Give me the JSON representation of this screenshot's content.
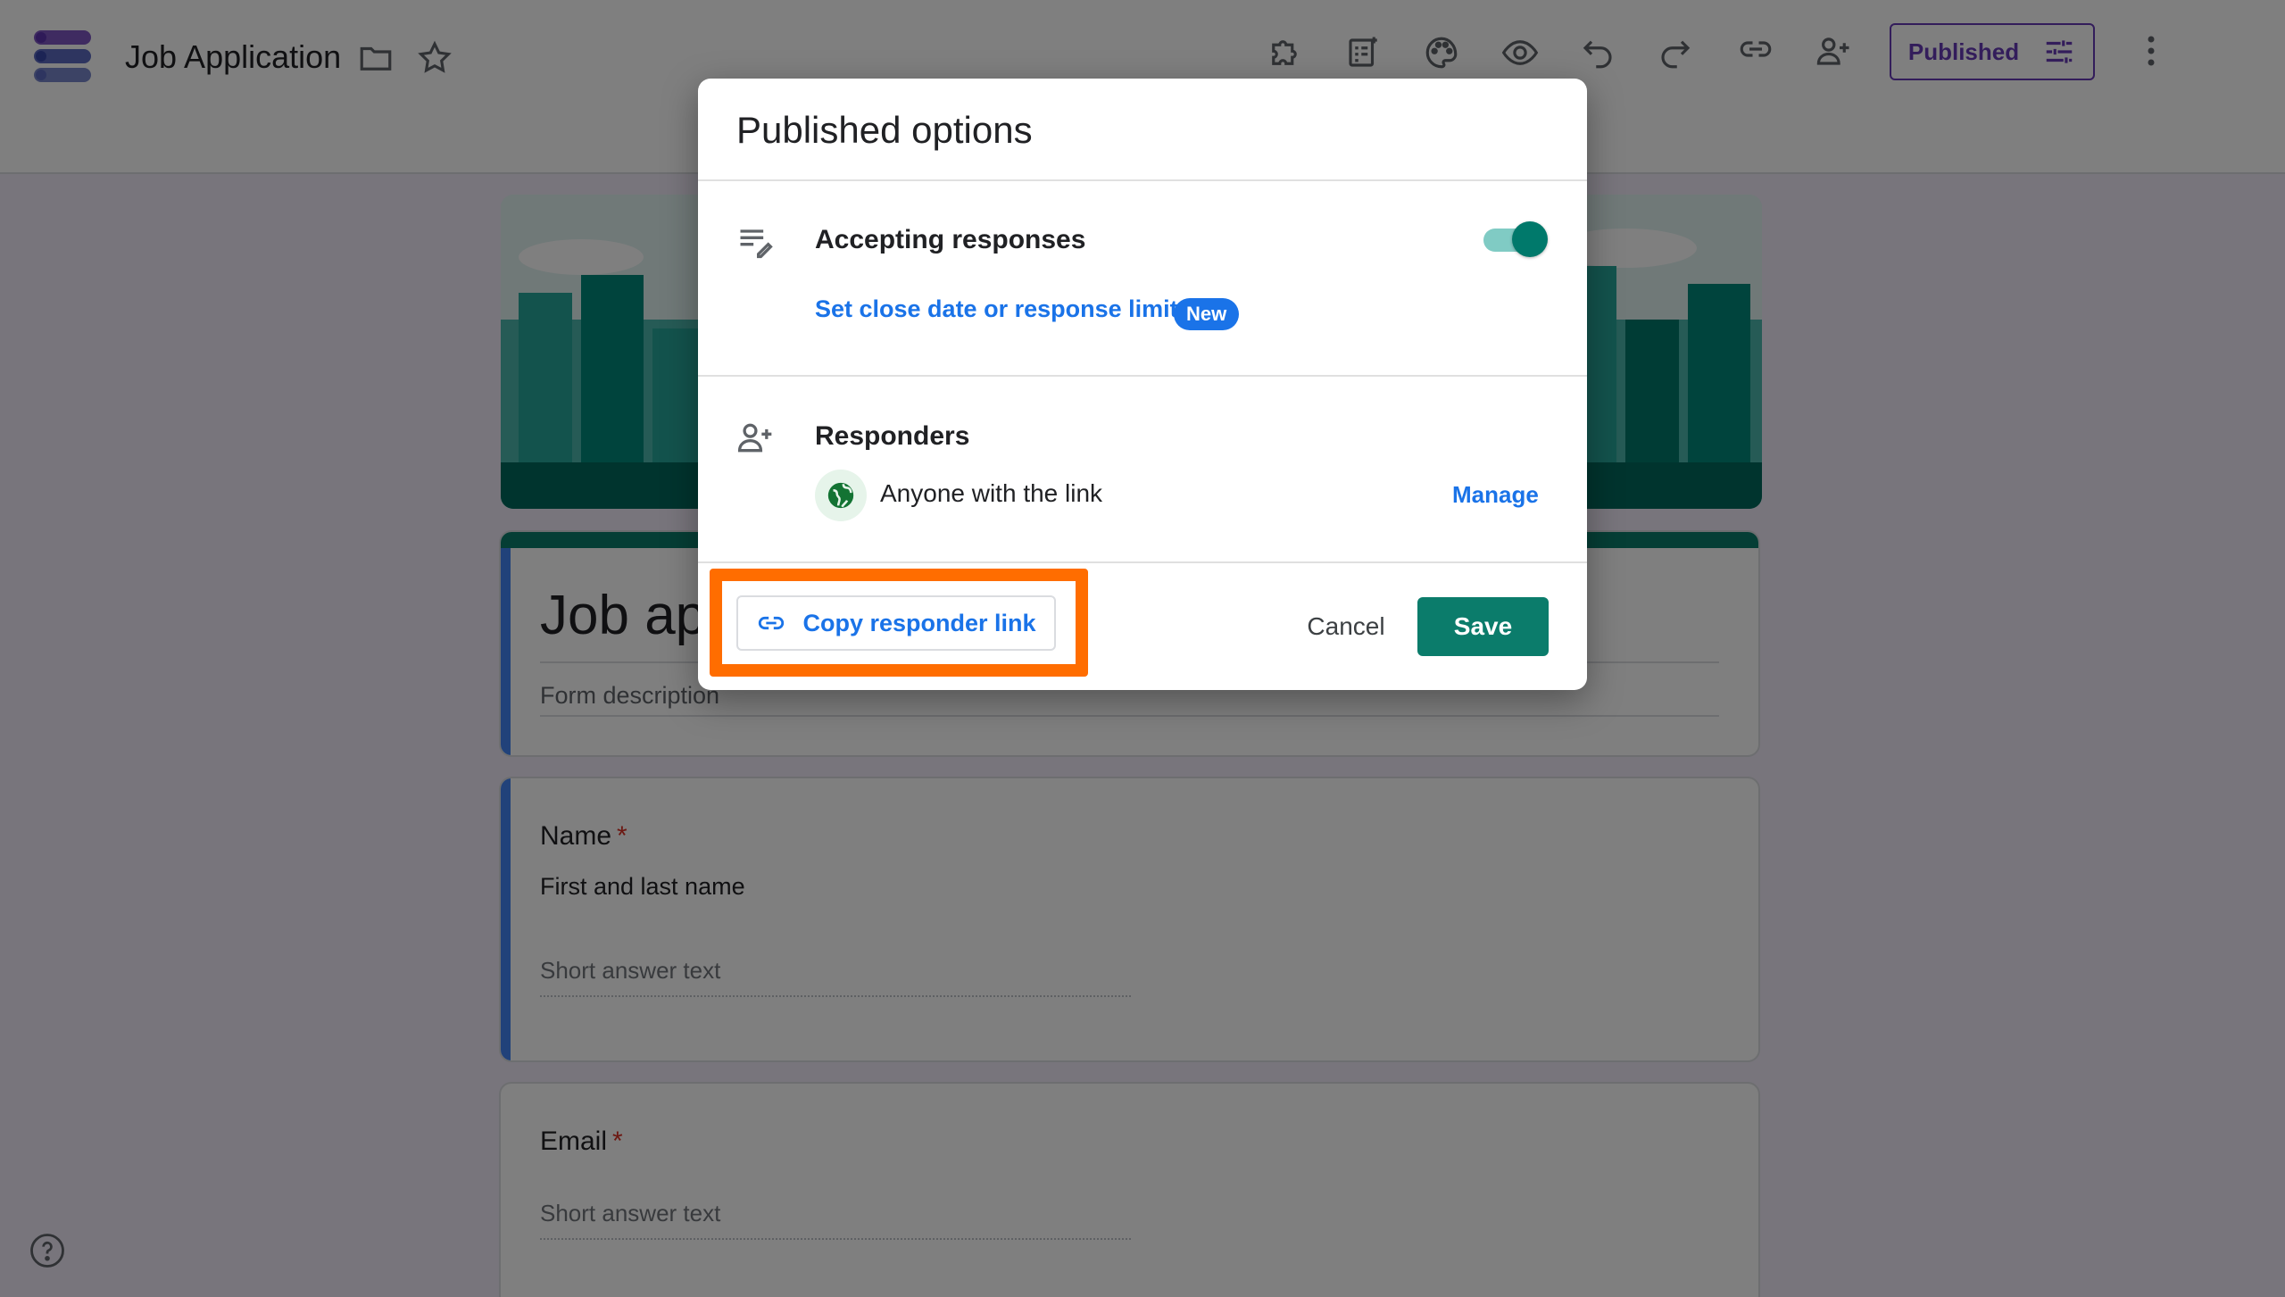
{
  "header": {
    "doc_title": "Job Application",
    "published_label": "Published"
  },
  "form": {
    "title": "Job ap",
    "description_placeholder": "Form description",
    "questions": [
      {
        "title": "Name",
        "required_mark": "*",
        "description": "First and last name",
        "answer_placeholder": "Short answer text"
      },
      {
        "title": "Email",
        "required_mark": "*",
        "answer_placeholder": "Short answer text"
      }
    ]
  },
  "dialog": {
    "title": "Published options",
    "accepting": {
      "label": "Accepting responses",
      "enabled": true,
      "limit_link": "Set close date or response limit",
      "badge": "New"
    },
    "responders": {
      "label": "Responders",
      "access": "Anyone with the link",
      "manage_label": "Manage"
    },
    "copy_link_label": "Copy responder link",
    "cancel_label": "Cancel",
    "save_label": "Save"
  },
  "colors": {
    "accent_purple": "#673ab7",
    "teal_primary": "#0b7c6b",
    "link_blue": "#1a73e8",
    "highlight_orange": "#ff6d00"
  },
  "icons": [
    "forms-logo-icon",
    "folder-icon",
    "star-icon",
    "addon-icon",
    "import-questions-icon",
    "palette-icon",
    "preview-eye-icon",
    "undo-icon",
    "redo-icon",
    "link-icon",
    "add-collaborator-icon",
    "tune-icon",
    "more-vert-icon",
    "help-icon",
    "list-edit-icon",
    "person-add-icon",
    "globe-icon"
  ]
}
